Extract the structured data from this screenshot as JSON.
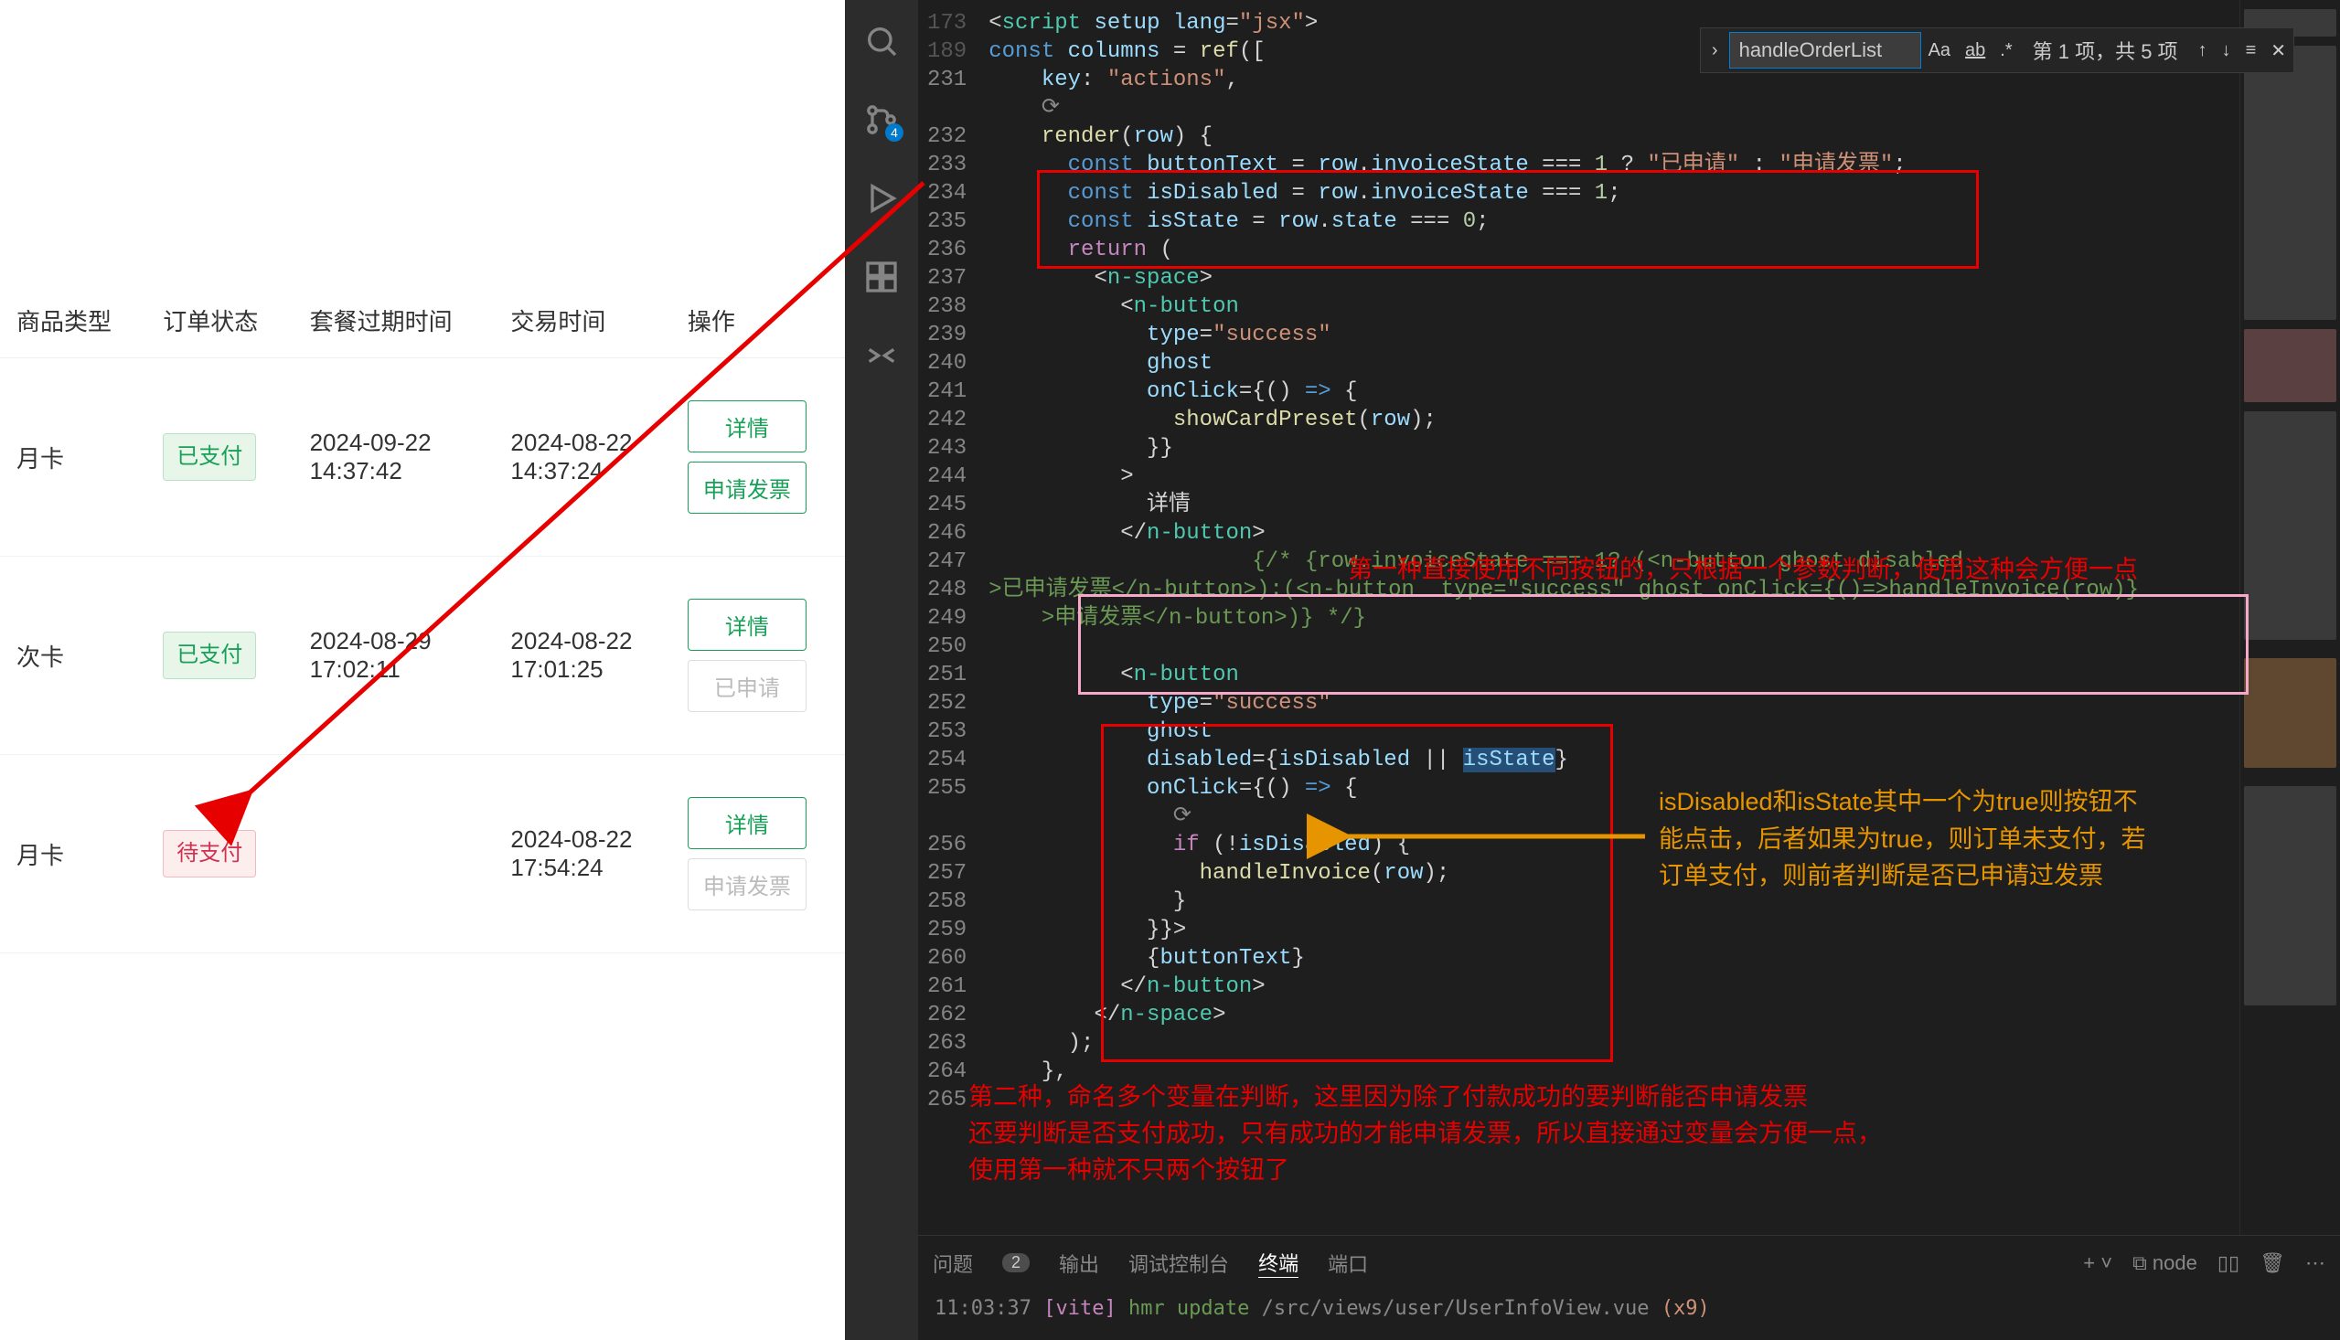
{
  "left_table": {
    "headers": [
      "商品类型",
      "订单状态",
      "套餐过期时间",
      "交易时间",
      "操作"
    ],
    "rows": [
      {
        "product": "月卡",
        "status": "已支付",
        "status_style": "green",
        "expire": "2024-09-22 14:37:42",
        "trade": "2024-08-22 14:37:24",
        "actions": [
          {
            "label": "详情",
            "style": "success"
          },
          {
            "label": "申请发票",
            "style": "success"
          }
        ]
      },
      {
        "product": "次卡",
        "status": "已支付",
        "status_style": "green",
        "expire": "2024-08-29 17:02:11",
        "trade": "2024-08-22 17:01:25",
        "actions": [
          {
            "label": "详情",
            "style": "success"
          },
          {
            "label": "已申请",
            "style": "ghost"
          }
        ]
      },
      {
        "product": "月卡",
        "status": "待支付",
        "status_style": "red",
        "expire": "",
        "trade": "2024-08-22 17:54:24",
        "actions": [
          {
            "label": "详情",
            "style": "success"
          },
          {
            "label": "申请发票",
            "style": "ghost"
          }
        ]
      }
    ]
  },
  "activity_bar": {
    "scm_badge": "4"
  },
  "find": {
    "value": "handleOrderList",
    "status": "第 1 项，共 5 项"
  },
  "gutter": [
    "173",
    "189",
    "231",
    "",
    "232",
    "233",
    "234",
    "235",
    "236",
    "237",
    "238",
    "239",
    "240",
    "241",
    "242",
    "243",
    "244",
    "245",
    "246",
    "247",
    "248",
    "249",
    "250",
    "251",
    "252",
    "253",
    "254",
    "255",
    "",
    "256",
    "257",
    "258",
    "259",
    "260",
    "261",
    "262",
    "263",
    "264",
    "265"
  ],
  "code": {
    "l0": "<script setup lang=\"jsx\">",
    "l1": "const columns = ref([",
    "l2": "    key: \"actions\",",
    "l3": "    ",
    "l4": "    render(row) {",
    "l5": "      const buttonText = row.invoiceState === 1 ? \"已申请\" : \"申请发票\";",
    "l6": "      const isDisabled = row.invoiceState === 1;",
    "l7": "      const isState = row.state === 0;",
    "l8": "      return (",
    "l9": "        <n-space>",
    "l10": "          <n-button",
    "l11": "            type=\"success\"",
    "l12": "            ghost",
    "l13": "            onClick={() => {",
    "l14": "              showCardPreset(row);",
    "l15": "            }}",
    "l16": "          >",
    "l17": "            详情",
    "l18": "          </n-button>",
    "l19a": "          {/* {row.invoiceState === 1? (<n-button ghost disabled",
    "l19b": ">已申请发票</n-button>):(<n-button  type=\"success\" ghost onClick={()=>handleInvoice(row)}",
    "l19c": "  >申请发票</n-button>)} */}",
    "l20": "",
    "l21": "          <n-button",
    "l22": "            type=\"success\"",
    "l23": "            ghost",
    "l24a": "            disabled={isDisabled || ",
    "l24b": "isState",
    "l24c": "}",
    "l25": "            onClick={() => {",
    "l26": "              ",
    "l27": "              if (!isDisabled) {",
    "l28": "                handleInvoice(row);",
    "l29": "              }",
    "l30": "            }}>",
    "l31": "            {buttonText}",
    "l32": "          </n-button>",
    "l33": "        </n-space>",
    "l34": "      );",
    "l35": "    },"
  },
  "annotations": {
    "comment1": "第一种直接使用不同按钮的，只根据一个参数判断，使用这种会方便一点",
    "comment2": "isDisabled和isState其中一个为true则按钮不能点击，后者如果为true，则订单未支付，若订单支付，则前者判断是否已申请过发票",
    "comment3_l1": "第二种，命名多个变量在判断，这里因为除了付款成功的要判断能否申请发票",
    "comment3_l2": "还要判断是否支付成功，只有成功的才能申请发票，所以直接通过变量会方便一点，",
    "comment3_l3": "使用第一种就不只两个按钮了"
  },
  "panel": {
    "tabs": [
      "问题",
      "输出",
      "调试控制台",
      "终端",
      "端口"
    ],
    "problem_count": "2",
    "right": [
      "node"
    ]
  },
  "terminal": {
    "time": "11:03:37",
    "tag": "[vite]",
    "msg": "hmr update",
    "path": "/src/views/user/UserInfoView.vue",
    "suffix": "(x9)"
  }
}
